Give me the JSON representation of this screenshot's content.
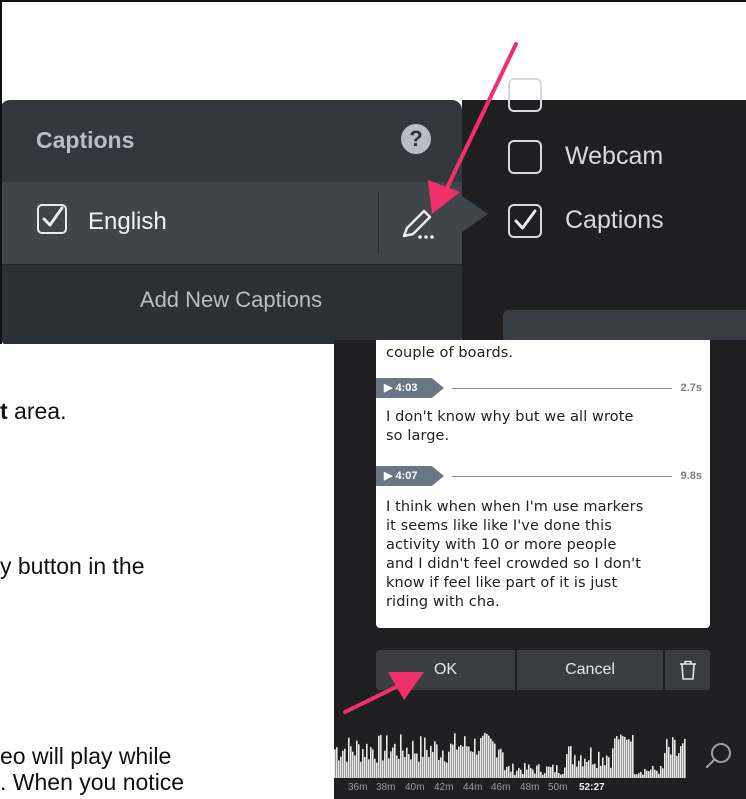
{
  "captions_menu": {
    "title": "Captions",
    "help_glyph": "?",
    "language_label": "English",
    "language_checked": true,
    "add_new_label": "Add New Captions"
  },
  "options": [
    {
      "label": "Webcam",
      "checked": false
    },
    {
      "label": "Captions",
      "checked": true
    }
  ],
  "caption_editor": {
    "entries": [
      {
        "timestamp": "",
        "duration": "",
        "text": "couple of  boards."
      },
      {
        "timestamp": "▶ 4:03",
        "duration": "2.7s",
        "text_lines": [
          "I don't know why but we all wrote",
          "so large."
        ]
      },
      {
        "timestamp": "▶ 4:07",
        "duration": "9.8s",
        "text_lines": [
          "I think when when I'm use markers",
          "it seems like like I've done this",
          "activity with 10 or more people",
          "and I didn't feel crowded so I don't",
          "know if feel like part of it is just",
          "riding with cha."
        ]
      }
    ],
    "ok_label": "OK",
    "cancel_label": "Cancel"
  },
  "timeline": {
    "ticks": [
      "36m",
      "38m",
      "40m",
      "42m",
      "44m",
      "46m",
      "48m",
      "50m",
      "52:27"
    ]
  },
  "document_fragments": {
    "line1_bold": "t",
    "line1_rest": " area.",
    "line2": "y button in the",
    "line3": "eo will play while",
    "line4": ". When you notice"
  },
  "colors": {
    "annotation_arrow": "#f0306a",
    "panel_dark": "#1f1f21",
    "menu_header": "#33373d",
    "menu_row": "#40454c"
  }
}
